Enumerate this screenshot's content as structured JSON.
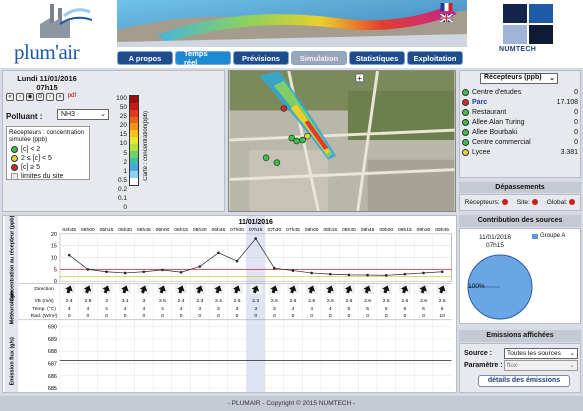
{
  "header": {
    "logo_text": "plum'air",
    "numtech_text": "NUMTECH"
  },
  "nav": {
    "tabs": [
      {
        "label": "A propos",
        "state": "normal"
      },
      {
        "label": "Temps réel",
        "state": "active"
      },
      {
        "label": "Prévisions",
        "state": "normal"
      },
      {
        "label": "Simulation",
        "state": "disabled"
      },
      {
        "label": "Statistiques",
        "state": "normal"
      },
      {
        "label": "Exploitation",
        "state": "normal"
      }
    ]
  },
  "left": {
    "date": "Lundi 11/01/2016",
    "time": "07h15",
    "controls": [
      "«",
      "‹",
      "◉",
      "⊙",
      "›",
      "»",
      "pdf"
    ],
    "pollutant_label": "Polluant :",
    "pollutant_value": "NH3",
    "legend_title": "Récepteurs : concentration simulée (ppb)",
    "legend": [
      {
        "label": "[c] < 2",
        "color": "#3bbf4a"
      },
      {
        "label": "2 ≤ [c] < 5",
        "color": "#e0d83a"
      },
      {
        "label": "[c] ≥ 5",
        "color": "#d02a2a"
      },
      {
        "label": "limites du site",
        "color": "#e8e8ee"
      }
    ],
    "colorbar_labels": [
      "100",
      "50",
      "25",
      "20",
      "15",
      "10",
      "5",
      "2",
      "1",
      "0.5",
      "0.2",
      "0.1",
      "0"
    ],
    "colorbar_colors": [
      "#9b0e0e",
      "#c51a1a",
      "#e33a1a",
      "#f06018",
      "#f49218",
      "#f6c01e",
      "#e6e630",
      "#b4dd3e",
      "#6ed26a",
      "#3ebfa6",
      "#46a8de",
      "#8fd0f0",
      "#ffffff"
    ],
    "colorbar_title": "Carte : concentration(ppb)"
  },
  "receptors": {
    "select_label": "Récepteurs (ppb)",
    "items": [
      {
        "name": "Centre d'etudes",
        "value": "0",
        "color": "#3bbf4a",
        "highlight": false
      },
      {
        "name": "Parc",
        "value": "17.108",
        "color": "#d02a2a",
        "highlight": true
      },
      {
        "name": "Restaurant",
        "value": "0",
        "color": "#3bbf4a",
        "highlight": false
      },
      {
        "name": "Allee Alan Turing",
        "value": "0",
        "color": "#3bbf4a",
        "highlight": false
      },
      {
        "name": "Allee Bourbaki",
        "value": "0",
        "color": "#3bbf4a",
        "highlight": false
      },
      {
        "name": "Centre commercial",
        "value": "0",
        "color": "#3bbf4a",
        "highlight": false
      },
      {
        "name": "Lycee",
        "value": "3.381",
        "color": "#e0d83a",
        "highlight": false
      }
    ]
  },
  "depassements": {
    "title": "Dépassements",
    "recepteurs": "Récepteurs:",
    "site": "Site:",
    "global": "Global:"
  },
  "contrib": {
    "title": "Contribution des sources",
    "date": "11/01/2016",
    "time": "07h15",
    "series": "Groupe A",
    "percent": "100%"
  },
  "emissions": {
    "title": "Emissions affichées",
    "source_label": "Source :",
    "source_value": "Toutes les sources",
    "param_label": "Paramètre :",
    "param_value": "flux",
    "button": "détails des émissions"
  },
  "timeseries": {
    "date": "11/01/2016",
    "ylabel": "Concentration au récepteur (ppb)",
    "meteo_label": "Météorologie",
    "emis_label": "Emission flux (g/s)",
    "row_labels": [
      "Direction",
      "VE.(m/s)",
      "Temp. (°C)",
      "Rad. (W/m²)"
    ],
    "times": [
      "04h45",
      "05h00",
      "05h15",
      "05h30",
      "05h45",
      "06h00",
      "06h15",
      "06h30",
      "06h45",
      "07h00",
      "07h15",
      "07h30",
      "07h45",
      "08h00",
      "08h15",
      "08h30",
      "08h45",
      "09h00",
      "09h15",
      "09h30",
      "09h45"
    ],
    "wind_speed": [
      "2.4",
      "2.8",
      "3",
      "3.1",
      "3",
      "2.5",
      "2.4",
      "2.3",
      "2.4",
      "2.5",
      "2.3",
      "2.5",
      "2.6",
      "2.6",
      "2.5",
      "2.6",
      "2.6",
      "2.5",
      "2.6",
      "2.6",
      "2.5"
    ],
    "temp": [
      "4",
      "4",
      "4",
      "4",
      "4",
      "4",
      "4",
      "3",
      "3",
      "3",
      "3",
      "3",
      "4",
      "4",
      "4",
      "5",
      "5",
      "6",
      "6",
      "6",
      "6"
    ],
    "rad": [
      "0",
      "0",
      "0",
      "0",
      "0",
      "0",
      "0",
      "0",
      "0",
      "0",
      "0",
      "0",
      "0",
      "0",
      "0",
      "0",
      "0",
      "0",
      "0",
      "0",
      "10"
    ],
    "emis_ticks": [
      "690",
      "689",
      "688",
      "687",
      "686",
      "685"
    ]
  },
  "chart_data": {
    "type": "line",
    "title": "11/01/2016",
    "ylabel": "Concentration au récepteur (ppb)",
    "categories": [
      "04h45",
      "05h00",
      "05h15",
      "05h30",
      "05h45",
      "06h00",
      "06h15",
      "06h30",
      "06h45",
      "07h00",
      "07h15",
      "07h30",
      "07h45",
      "08h00",
      "08h15",
      "08h30",
      "08h45",
      "09h00",
      "09h15",
      "09h30",
      "09h45"
    ],
    "values": [
      11,
      5,
      4,
      3.5,
      4,
      4.8,
      3.8,
      6.2,
      12,
      8.5,
      18,
      5.5,
      4.5,
      3.5,
      3,
      2.7,
      2.6,
      2.5,
      3,
      3.5,
      4
    ],
    "ylim": [
      0,
      20
    ],
    "yticks": [
      0,
      5,
      10,
      15,
      20
    ]
  },
  "footer": "- PLUMAIR - Copyright © 2015 NUMTECH -"
}
